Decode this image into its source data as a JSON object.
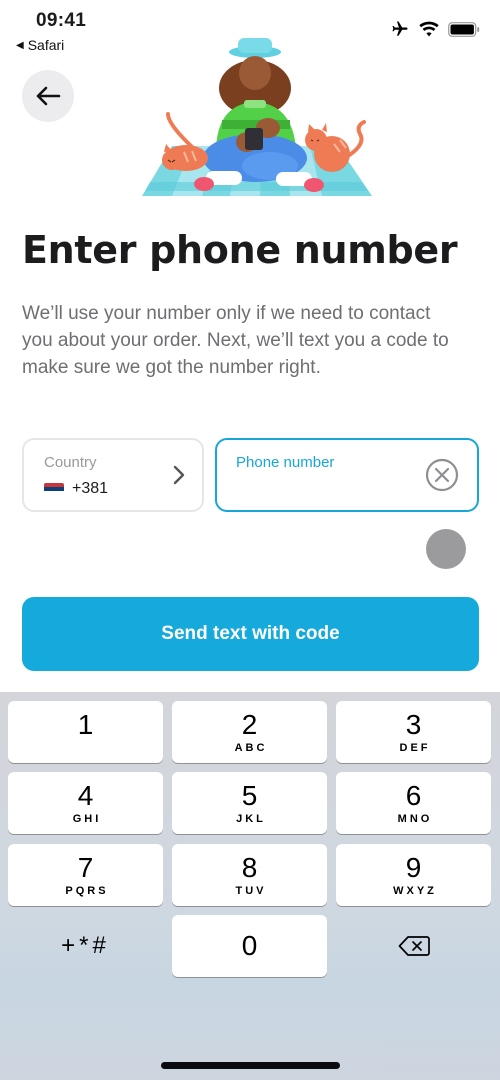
{
  "status_bar": {
    "time": "09:41",
    "back_app": "Safari",
    "back_app_icon": "triangle-left-icon",
    "icons": [
      "airplane-icon",
      "wifi-icon",
      "battery-icon"
    ]
  },
  "header": {
    "back_icon": "arrow-left-icon",
    "illustration": "person-with-phone-and-cats-illustration"
  },
  "main": {
    "title": "Enter phone number",
    "description": "We’ll use your number only if we need to contact you about your order. Next, we’ll text you a code to make sure we got the number right."
  },
  "form": {
    "country": {
      "label": "Country",
      "flag": "Serbia",
      "dial_code": "+381",
      "chevron_icon": "chevron-right-icon"
    },
    "phone": {
      "label": "Phone number",
      "value": "",
      "clear_icon": "clear-circle-x-icon"
    },
    "submit_label": "Send text with code",
    "accent_color": "#16a9dc"
  },
  "keyboard": {
    "keys": [
      {
        "digit": "1",
        "letters": ""
      },
      {
        "digit": "2",
        "letters": "ABC"
      },
      {
        "digit": "3",
        "letters": "DEF"
      },
      {
        "digit": "4",
        "letters": "GHI"
      },
      {
        "digit": "5",
        "letters": "JKL"
      },
      {
        "digit": "6",
        "letters": "MNO"
      },
      {
        "digit": "7",
        "letters": "PQRS"
      },
      {
        "digit": "8",
        "letters": "TUV"
      },
      {
        "digit": "9",
        "letters": "WXYZ"
      },
      {
        "digit": "0",
        "letters": ""
      }
    ],
    "symbols_key": "+*#",
    "delete_icon": "backspace-icon"
  }
}
